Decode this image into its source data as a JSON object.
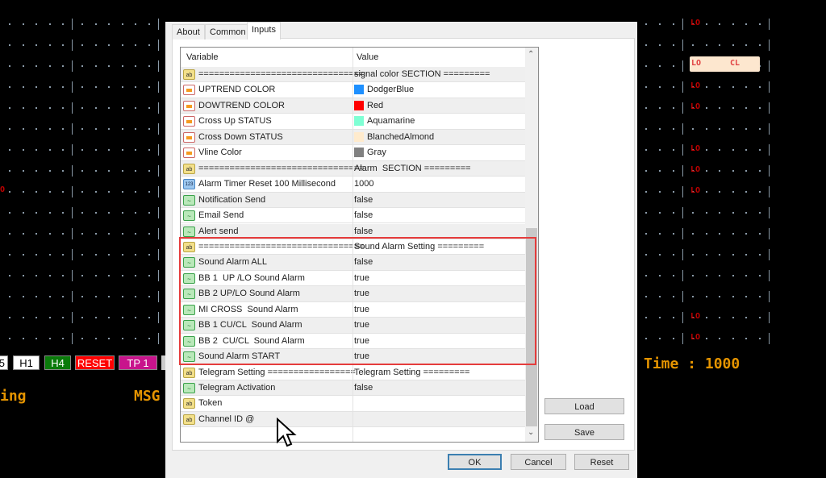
{
  "chart_bg": {
    "lo_label": "LO",
    "cl_label": "CL",
    "left_o": "O",
    "timeframe_buttons": [
      {
        "label": "5",
        "bg": "#ffffff",
        "fg": "#000000"
      },
      {
        "label": "H1",
        "bg": "#ffffff",
        "fg": "#000000"
      },
      {
        "label": "H4",
        "bg": "#0a7a0a",
        "fg": "#ffffff"
      },
      {
        "label": "RESET",
        "bg": "#ff0000",
        "fg": "#ffffff"
      },
      {
        "label": "TP 1",
        "bg": "#c8148c",
        "fg": "#ffffff"
      }
    ],
    "status_left": "ing",
    "msg_label": "MSG",
    "time_label": "Time : 1000"
  },
  "dialog": {
    "tabs": [
      "About",
      "Common",
      "Inputs"
    ],
    "active_tab": "Inputs",
    "columns": {
      "variable": "Variable",
      "value": "Value"
    },
    "rows": [
      {
        "icon": "ab",
        "var": "================================",
        "val": "signal color SECTION ========="
      },
      {
        "icon": "clr",
        "var": "UPTREND COLOR",
        "val": "DodgerBlue",
        "color": "#1e90ff"
      },
      {
        "icon": "clr",
        "var": "DOWTREND COLOR",
        "val": "Red",
        "color": "#ff0000"
      },
      {
        "icon": "clr",
        "var": "Cross Up STATUS",
        "val": "Aquamarine",
        "color": "#7fffd4"
      },
      {
        "icon": "clr",
        "var": "Cross Down STATUS",
        "val": "BlanchedAlmond",
        "color": "#ffebcd"
      },
      {
        "icon": "clr",
        "var": "Vline Color",
        "val": "Gray",
        "color": "#808080"
      },
      {
        "icon": "ab",
        "var": "================================",
        "val": "Alarm  SECTION ========="
      },
      {
        "icon": "num",
        "var": "Alarm Timer Reset 100 Millisecond",
        "val": "1000"
      },
      {
        "icon": "bool",
        "var": "Notification Send",
        "val": "false"
      },
      {
        "icon": "bool",
        "var": "Email Send",
        "val": "false"
      },
      {
        "icon": "bool",
        "var": "Alert send",
        "val": "false"
      },
      {
        "icon": "ab",
        "var": "================================",
        "val": "Sound Alarm Setting ========="
      },
      {
        "icon": "bool",
        "var": "Sound Alarm ALL",
        "val": "false"
      },
      {
        "icon": "bool",
        "var": "BB 1  UP /LO Sound Alarm",
        "val": "true"
      },
      {
        "icon": "bool",
        "var": "BB 2 UP/LO Sound Alarm",
        "val": "true"
      },
      {
        "icon": "bool",
        "var": "MI CROSS  Sound Alarm",
        "val": "true"
      },
      {
        "icon": "bool",
        "var": "BB 1 CU/CL  Sound Alarm",
        "val": "true"
      },
      {
        "icon": "bool",
        "var": "BB 2  CU/CL  Sound Alarm",
        "val": "true"
      },
      {
        "icon": "bool",
        "var": "Sound Alarm START",
        "val": "true"
      },
      {
        "icon": "ab",
        "var": "Telegram Setting =================",
        "val": "Telegram Setting ========="
      },
      {
        "icon": "bool",
        "var": "Telegram Activation",
        "val": "false"
      },
      {
        "icon": "ab",
        "var": "Token",
        "val": ""
      },
      {
        "icon": "ab",
        "var": "Channel ID @",
        "val": ""
      }
    ],
    "icon_labels": {
      "ab": "ab",
      "num": "123",
      "bool": "~"
    },
    "highlight_color": "#e53c3c",
    "buttons": {
      "load": "Load",
      "save": "Save",
      "ok": "OK",
      "cancel": "Cancel",
      "reset": "Reset"
    }
  }
}
